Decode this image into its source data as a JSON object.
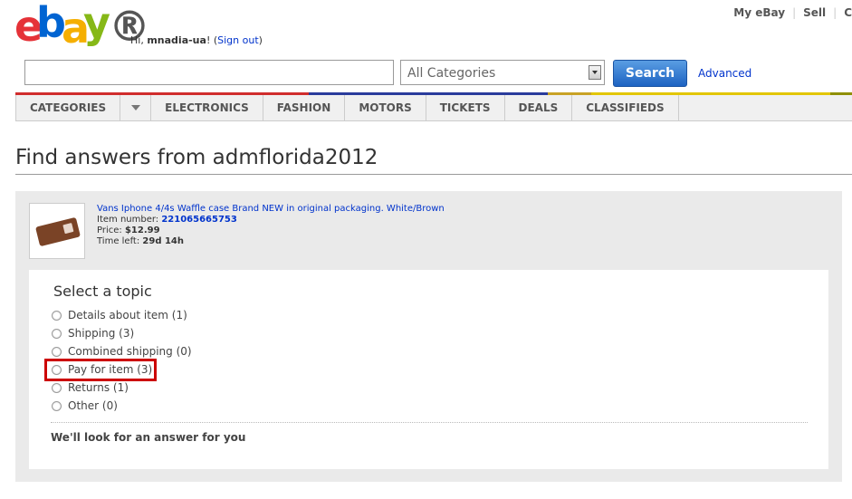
{
  "header": {
    "logo_letters": [
      "e",
      "b",
      "a",
      "y"
    ],
    "logo_reg": "®",
    "greeting_prefix": "Hi, ",
    "username": "mnadia-ua",
    "greeting_exclaim": "! (",
    "sign_out": "Sign out",
    "greeting_close": ")",
    "top_links": [
      "My eBay",
      "Sell",
      "C"
    ]
  },
  "search": {
    "query": "",
    "category": "All Categories",
    "button_label": "Search",
    "advanced_label": "Advanced"
  },
  "nav": {
    "items": [
      "CATEGORIES",
      "ELECTRONICS",
      "FASHION",
      "MOTORS",
      "TICKETS",
      "DEALS",
      "CLASSIFIEDS"
    ]
  },
  "page": {
    "title": "Find answers from admflorida2012"
  },
  "item": {
    "title": "Vans Iphone 4/4s Waffle case Brand NEW in original packaging. White/Brown",
    "number_label": "Item number: ",
    "number": "221065665753",
    "price_label": "Price: ",
    "price": "$12.99",
    "time_label": "Time left: ",
    "time": "29d 14h"
  },
  "topics": {
    "heading": "Select a topic",
    "options": [
      "Details about item (1)",
      "Shipping (3)",
      "Combined shipping (0)",
      "Pay for item (3)",
      "Returns (1)",
      "Other (0)"
    ],
    "highlighted_index": 3,
    "footer": "We'll look for an answer for you"
  },
  "colors": {
    "logo_e": "#e53238",
    "logo_b": "#0064d2",
    "logo_a": "#f5af02",
    "logo_y": "#86b817",
    "link": "#0033cc",
    "highlight": "#cc0000",
    "search_button": "#1d63c2"
  }
}
